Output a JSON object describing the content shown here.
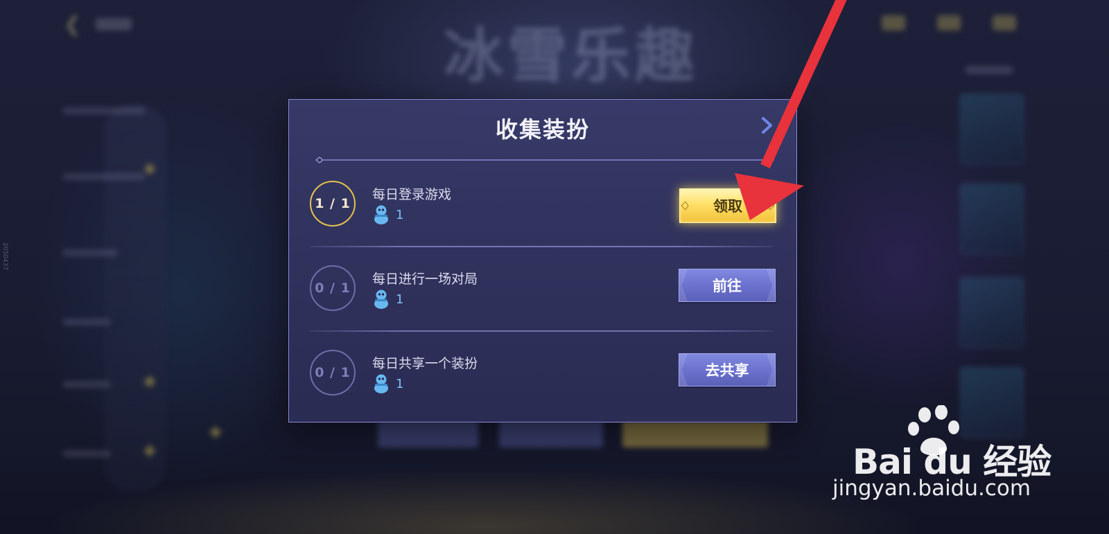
{
  "background": {
    "event_title": "冰雪乐趣",
    "side_vertical_text": "2050437"
  },
  "dialog": {
    "title": "收集装扮",
    "close_icon": "chevron-right-icon",
    "tasks": [
      {
        "progress": "1 / 1",
        "completed": true,
        "label": "每日登录游戏",
        "reward_icon": "snowman-icon",
        "reward_count": "1",
        "button_label": "领取",
        "button_style": "gold"
      },
      {
        "progress": "0 / 1",
        "completed": false,
        "label": "每日进行一场对局",
        "reward_icon": "snowman-icon",
        "reward_count": "1",
        "button_label": "前往",
        "button_style": "blue"
      },
      {
        "progress": "0 / 1",
        "completed": false,
        "label": "每日共享一个装扮",
        "reward_icon": "snowman-icon",
        "reward_count": "1",
        "button_label": "去共享",
        "button_style": "blue"
      }
    ]
  },
  "annotation": {
    "arrow_color": "#e8323c"
  },
  "watermark": {
    "logo_text": "Bai du 经验",
    "url": "jingyan.baidu.com"
  },
  "colors": {
    "gold_button": "#ffe068",
    "blue_button": "#6a70cc",
    "dialog_border": "#8b8bd6",
    "reward_count": "#7fc0f4"
  }
}
